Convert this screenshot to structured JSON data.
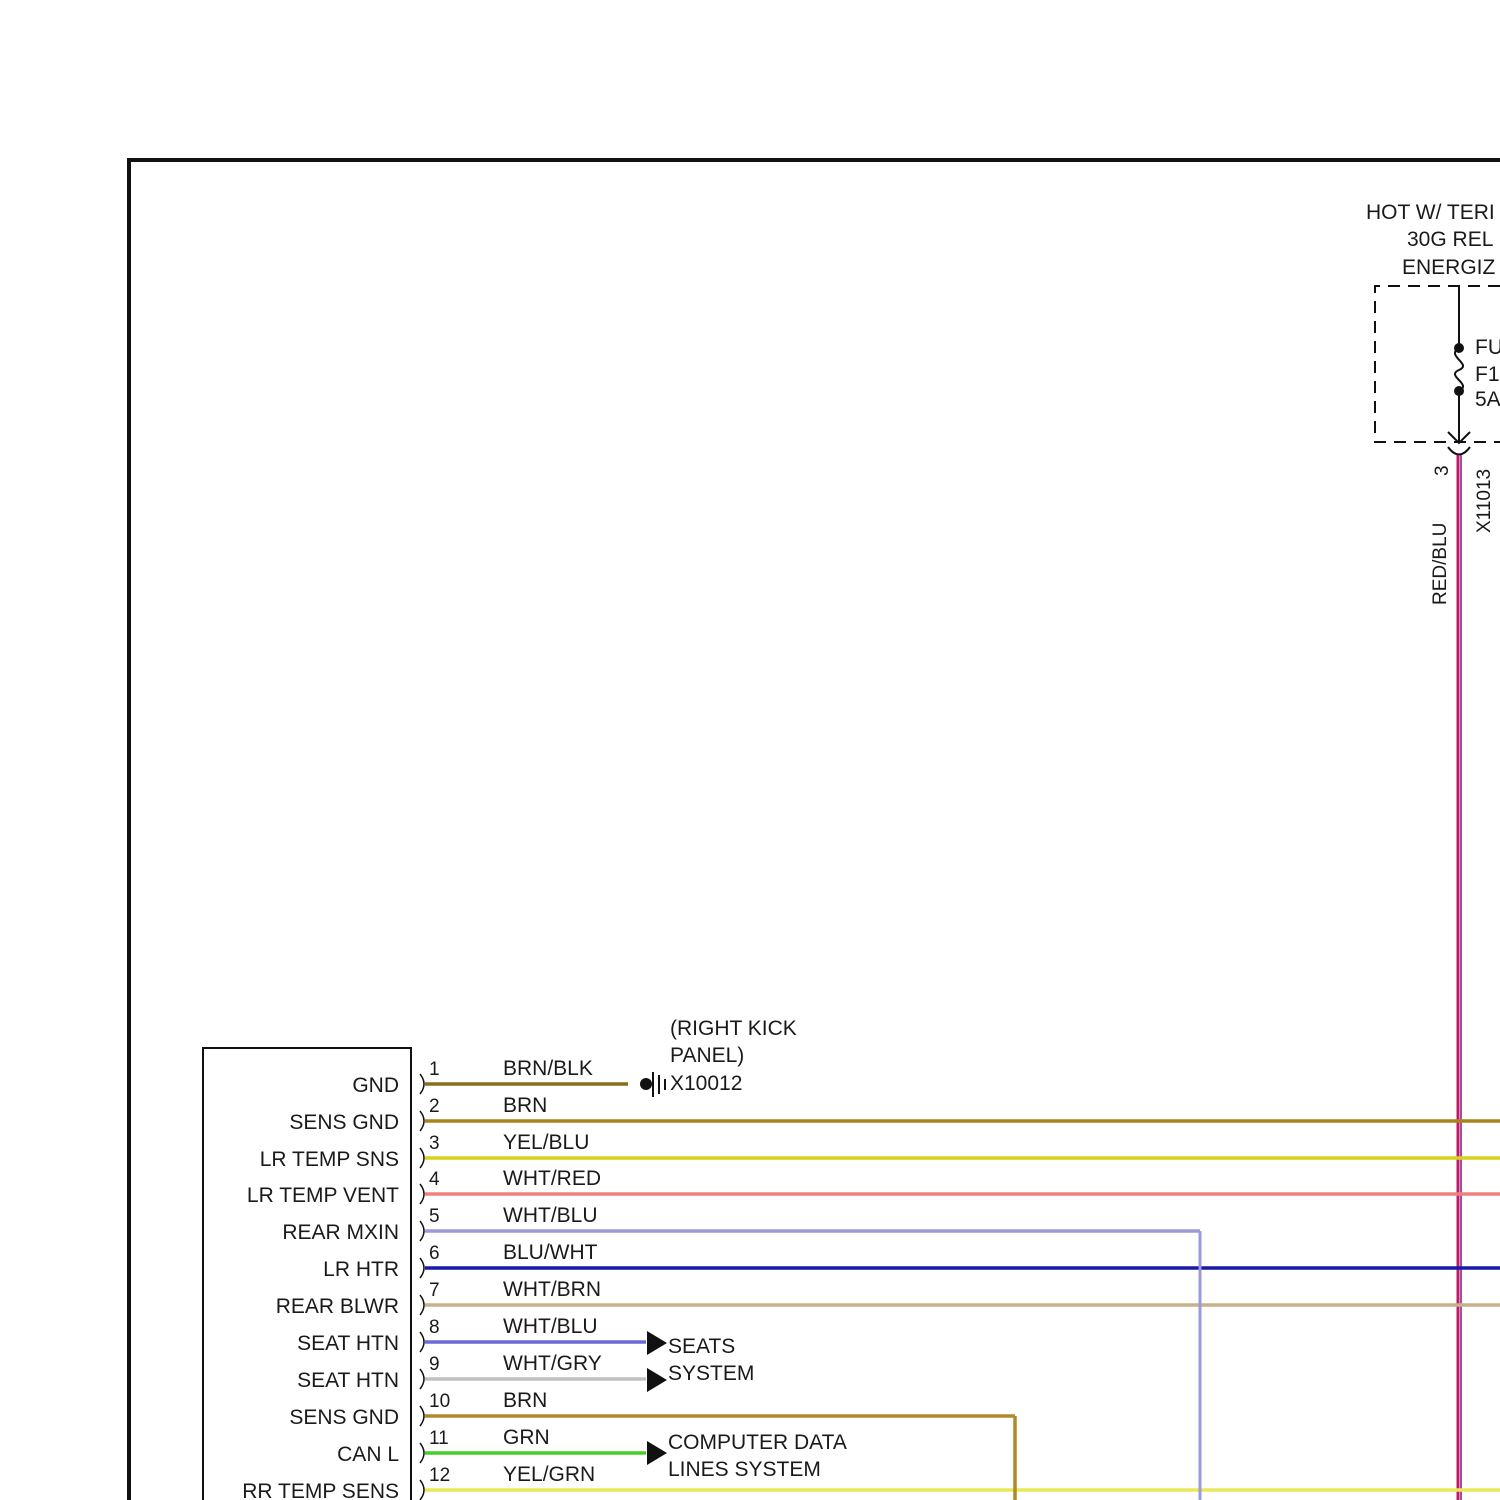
{
  "diagram": {
    "hot_label": [
      "HOT W/ TERI",
      "30G REL",
      "ENERGIZ"
    ],
    "fuse": {
      "label": [
        "FU",
        "F1",
        "5A"
      ]
    },
    "connector_x11013": {
      "id": "X11013",
      "pin": "3",
      "wire_color": "RED/BLU"
    },
    "ground": {
      "location": [
        "(RIGHT KICK",
        "PANEL)"
      ],
      "id": "X10012"
    },
    "module_pins": [
      {
        "num": "1",
        "name": "GND",
        "wire": "BRN/BLK",
        "color": "#8a6d1a"
      },
      {
        "num": "2",
        "name": "SENS GND",
        "wire": "BRN",
        "color": "#a8841a"
      },
      {
        "num": "3",
        "name": "LR TEMP SNS",
        "wire": "YEL/BLU",
        "color": "#d6d21a"
      },
      {
        "num": "4",
        "name": "LR TEMP VENT",
        "wire": "WHT/RED",
        "color": "#f08080"
      },
      {
        "num": "5",
        "name": "REAR MXIN",
        "wire": "WHT/BLU",
        "color": "#9a9ad8"
      },
      {
        "num": "6",
        "name": "LR HTR",
        "wire": "BLU/WHT",
        "color": "#1a1aa8"
      },
      {
        "num": "7",
        "name": "REAR BLWR",
        "wire": "WHT/BRN",
        "color": "#c8b08a"
      },
      {
        "num": "8",
        "name": "SEAT HTN",
        "wire": "WHT/BLU",
        "color": "#6a6ad8"
      },
      {
        "num": "9",
        "name": "SEAT HTN",
        "wire": "WHT/GRY",
        "color": "#c0c0c0"
      },
      {
        "num": "10",
        "name": "SENS GND",
        "wire": "BRN",
        "color": "#b08a2a"
      },
      {
        "num": "11",
        "name": "CAN L",
        "wire": "GRN",
        "color": "#44d02a"
      },
      {
        "num": "12",
        "name": "RR TEMP SENS",
        "wire": "YEL/GRN",
        "color": "#e8e85a"
      }
    ],
    "seats_label": [
      "SEATS",
      "SYSTEM"
    ],
    "cdl_label": [
      "COMPUTER DATA",
      "LINES SYSTEM"
    ]
  }
}
